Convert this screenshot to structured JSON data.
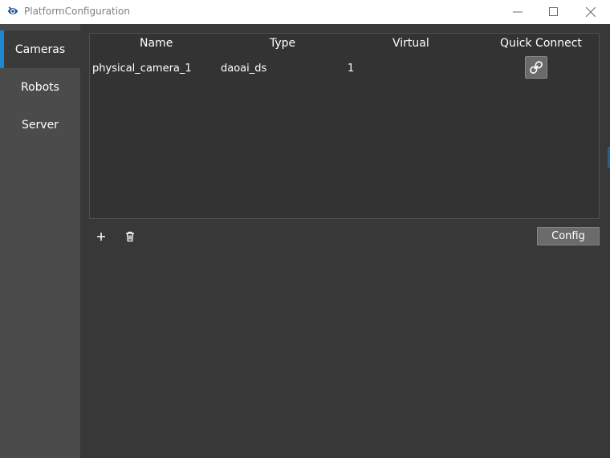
{
  "window": {
    "title": "PlatformConfiguration",
    "icons": {
      "app": "camera-eye-icon",
      "minimize": "minimize-icon",
      "maximize": "maximize-icon",
      "close": "close-icon"
    }
  },
  "sidebar": {
    "items": [
      {
        "label": "Cameras",
        "active": true
      },
      {
        "label": "Robots",
        "active": false
      },
      {
        "label": "Server",
        "active": false
      }
    ],
    "accent_color": "#1f86d4"
  },
  "table": {
    "columns": [
      "Name",
      "Type",
      "Virtual",
      "Quick Connect"
    ],
    "rows": [
      {
        "name": "physical_camera_1",
        "type": "daoai_ds",
        "virtual": "1",
        "quick_connect_icon": "link-icon"
      }
    ]
  },
  "toolbar": {
    "add_icon": "plus-icon",
    "delete_icon": "trash-icon",
    "config_label": "Config"
  }
}
